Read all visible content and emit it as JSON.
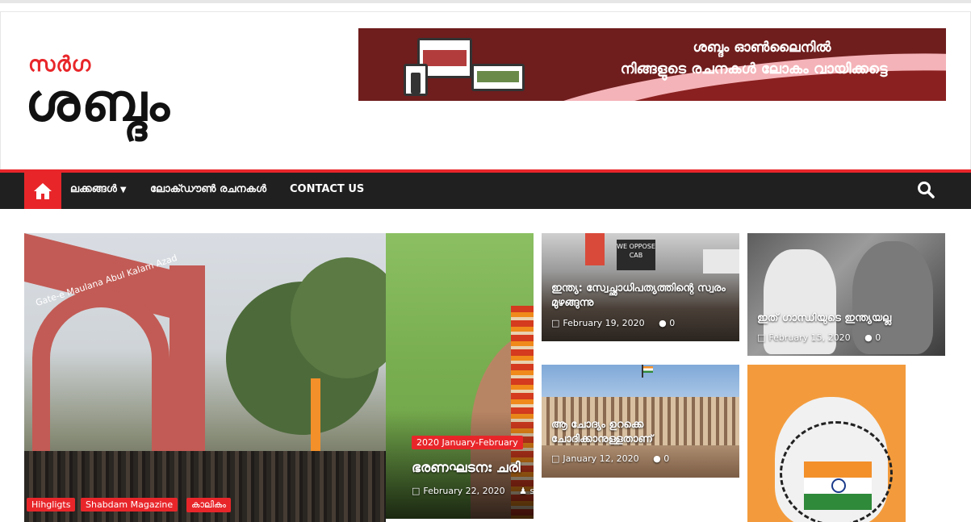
{
  "logo": {
    "small": "സർഗ",
    "big": "ശബ്ദം"
  },
  "banner": {
    "line1": "ശബ്ദം ഓൺലൈനിൽ",
    "line2": "നിങ്ങളുടെ രചനകൾ ലോകം വായിക്കട്ടെ"
  },
  "nav": {
    "items": [
      {
        "label": "ലക്കങ്ങൾ",
        "has_dropdown": true
      },
      {
        "label": "ലോക്ഡൗൺ രചനകൾ"
      },
      {
        "label": "CONTACT US"
      }
    ],
    "home_icon": "home-icon",
    "search_icon": "search-icon"
  },
  "main_tile": {
    "sign": "Gate-e Maulana Abul Kalam Azad",
    "tags": [
      "Hihgligts",
      "Shabdam Magazine",
      "കാലികം"
    ]
  },
  "second_tile": {
    "category": "2020 January-February",
    "title": "ഭരണഘടനഃ ചരി",
    "date": "February 22, 2020",
    "author": "sh"
  },
  "cards": [
    {
      "title": "ഇന്ത്യ: സ്വേച്ഛാധിപത്യത്തിന്റെ സ്വരം മുഴങ്ങുന്നു",
      "date": "February 19, 2020",
      "comments": "0",
      "sign": "WE OPPOSE CAB"
    },
    {
      "title": "ഇത് ഗാന്ധിയുടെ ഇന്ത്യയല്ല",
      "date": "February 15, 2020",
      "comments": "0"
    },
    {
      "title": "ആ ചോദ്യം ഉറക്കെ ചോദിക്കാനുള്ളതാണ്",
      "date": "January 12, 2020",
      "comments": "0"
    }
  ],
  "colors": {
    "accent": "#e8262a",
    "nav_bg": "#202020",
    "banner_bg": "#6f1d1d"
  }
}
